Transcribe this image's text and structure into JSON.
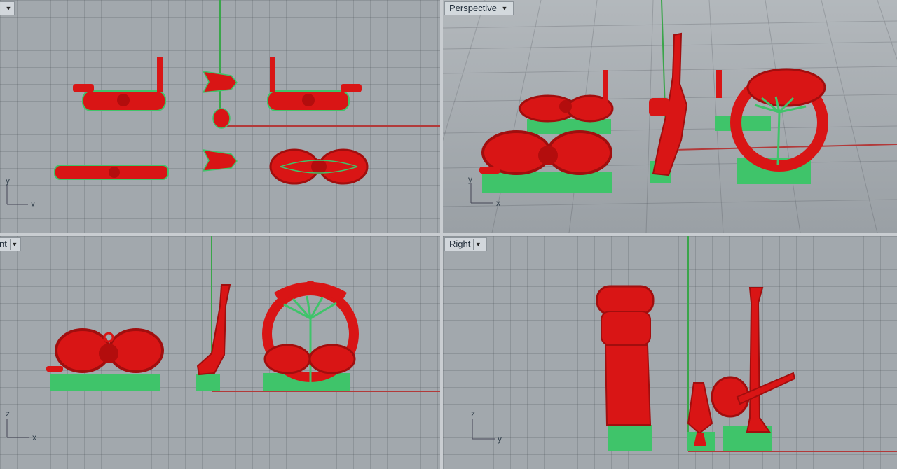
{
  "viewports": {
    "top": {
      "label": ""
    },
    "perspective": {
      "label": "Perspective"
    },
    "front": {
      "label": "nt"
    },
    "right": {
      "label": "Right"
    }
  },
  "axes": {
    "top": {
      "h": "x",
      "v": "y"
    },
    "perspective": {
      "h": "x",
      "v": "y"
    },
    "front": {
      "h": "x",
      "v": "z"
    },
    "right": {
      "h": "y",
      "v": "z"
    }
  },
  "colors": {
    "model": "#d91515",
    "supports": "#3fc46a",
    "x_axis": "#b23a3a",
    "y_axis": "#3aa54a"
  },
  "icons": {
    "viewport_menu": "caret-down-icon"
  }
}
